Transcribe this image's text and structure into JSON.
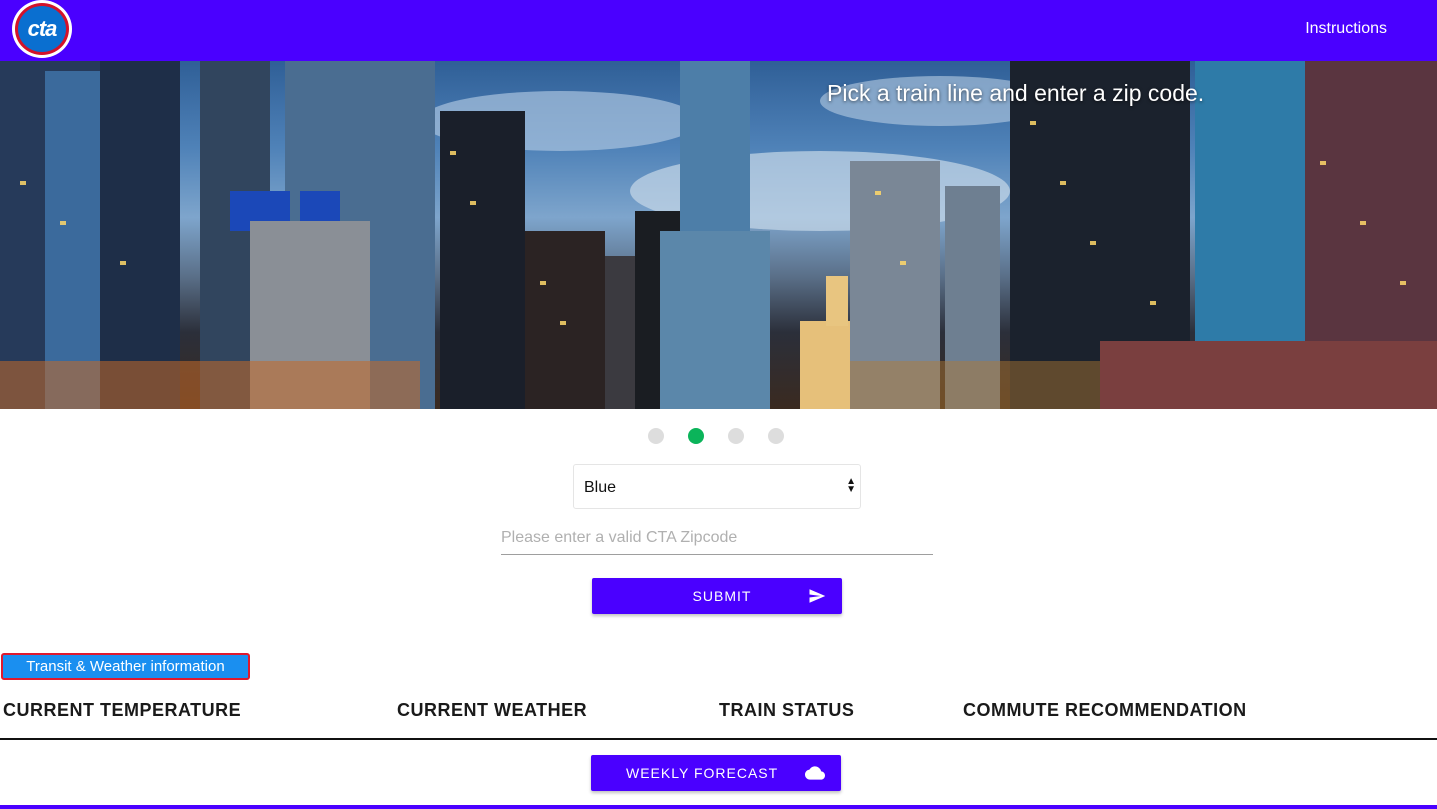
{
  "navbar": {
    "logo_text": "cta",
    "instructions_label": "Instructions",
    "color": "#4a00ff"
  },
  "hero": {
    "caption": "Pick a train line and enter a zip code.",
    "image": "chicago-skyline-night-photo"
  },
  "carousel": {
    "active_index": 1,
    "count": 4,
    "active_color": "#0bb45a"
  },
  "form": {
    "line_select_value": "Blue",
    "zip_placeholder": "Please enter a valid CTA Zipcode",
    "zip_value": "",
    "submit_label": "SUBMIT",
    "submit_icon": "send-icon"
  },
  "info": {
    "section_label": "Transit & Weather information",
    "columns": [
      "CURRENT TEMPERATURE",
      "CURRENT WEATHER",
      "TRAIN STATUS",
      "COMMUTE RECOMMENDATION"
    ],
    "forecast_label": "WEEKLY FORECAST",
    "forecast_icon": "cloud-icon"
  }
}
